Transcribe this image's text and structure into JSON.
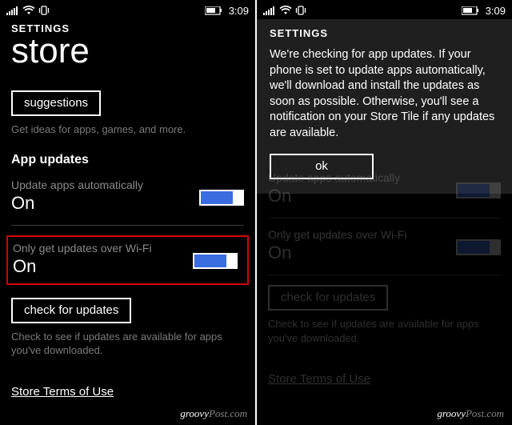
{
  "status": {
    "time": "3:09"
  },
  "left": {
    "settings_label": "SETTINGS",
    "page_title": "store",
    "suggestions_button": "suggestions",
    "suggestions_hint": "Get ideas for apps, games, and more.",
    "section_title": "App updates",
    "auto_update": {
      "label": "Update apps automatically",
      "value": "On"
    },
    "wifi_only": {
      "label": "Only get updates over Wi-Fi",
      "value": "On"
    },
    "check_button": "check for updates",
    "check_hint": "Check to see if updates are available for apps you've downloaded.",
    "terms_link": "Store Terms of Use"
  },
  "right": {
    "settings_label": "SETTINGS",
    "dialog_text": "We're checking for app updates. If your phone is set to update apps automatically, we'll download and install the updates as soon as possible. Otherwise, you'll see a notification on your Store Tile if any updates are available.",
    "ok_button": "ok",
    "auto_update": {
      "label": "Update apps automatically",
      "value": "On"
    },
    "wifi_only": {
      "label": "Only get updates over Wi-Fi",
      "value": "On"
    },
    "check_button": "check for updates",
    "check_hint": "Check to see if updates are available for apps you've downloaded.",
    "terms_link": "Store Terms of Use"
  },
  "watermark": {
    "brand": "groovy",
    "suffix": "Post.com"
  }
}
